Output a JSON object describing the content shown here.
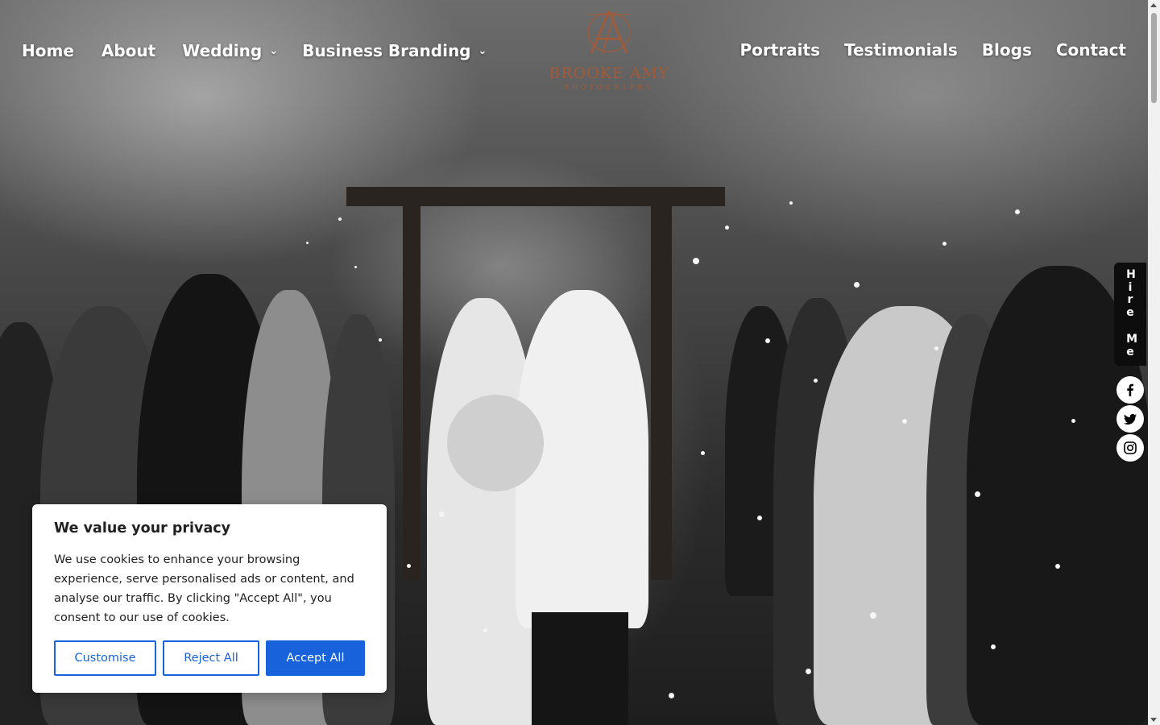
{
  "nav": {
    "left": [
      {
        "label": "Home",
        "has_dropdown": false
      },
      {
        "label": "About",
        "has_dropdown": false
      },
      {
        "label": "Wedding",
        "has_dropdown": true
      },
      {
        "label": "Business Branding",
        "has_dropdown": true
      }
    ],
    "right": [
      {
        "label": "Portraits"
      },
      {
        "label": "Testimonials"
      },
      {
        "label": "Blogs"
      },
      {
        "label": "Contact"
      }
    ],
    "dropdown_glyph": "⌄"
  },
  "logo": {
    "name": "BROOKE AMY",
    "tagline": "PHOTOGRAPHY",
    "color": "#a55a37"
  },
  "hire_tab": {
    "line1": "Hire",
    "line2": "Me"
  },
  "social": [
    {
      "icon": "facebook-icon"
    },
    {
      "icon": "twitter-icon"
    },
    {
      "icon": "instagram-icon"
    }
  ],
  "cookie": {
    "title": "We value your privacy",
    "body": "We use cookies to enhance your browsing experience, serve personalised ads or content, and analyse our traffic. By clicking \"Accept All\", you consent to our use of cookies.",
    "customise_label": "Customise",
    "reject_label": "Reject All",
    "accept_label": "Accept All",
    "accent_color": "#1863dc"
  }
}
